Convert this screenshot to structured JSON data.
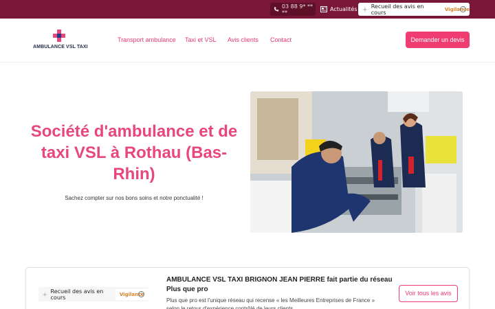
{
  "topbar": {
    "phone": "03 88 9* ** **",
    "news_label": "Actualités",
    "review_label": "Recueil des avis en cours",
    "vigilance_label": "Vigilance",
    "info_label": "i"
  },
  "logo": {
    "text": "AMBULANCE VSL TAXI"
  },
  "nav": {
    "items": [
      "Transport ambulance",
      "Taxi et VSL",
      "Avis clients",
      "Contact"
    ],
    "cta_label": "Demander un devis"
  },
  "hero": {
    "title": "Société d'ambulance et de taxi VSL à Rothau (Bas-Rhin)",
    "subtitle": "Sachez compter sur nos bons soins et notre ponctualité !"
  },
  "reviews": {
    "pill_label": "Recueil des avis en cours",
    "vigilance_label": "Vigilance",
    "info_label": "i",
    "title": "AMBULANCE VSL TAXI BRIGNON JEAN PIERRE fait partie du réseau Plus que pro",
    "body": "Plus que pro est l'unique réseau qui recense « les Meilleures Entreprises de France » selon le retour d'expérience contrôlé de leurs clients.",
    "button_label": "Voir tous les avis"
  },
  "colors": {
    "topbar": "#7a1739",
    "accent": "#ef3d72",
    "title": "#e8477b",
    "vigilance": "#d9822b"
  }
}
